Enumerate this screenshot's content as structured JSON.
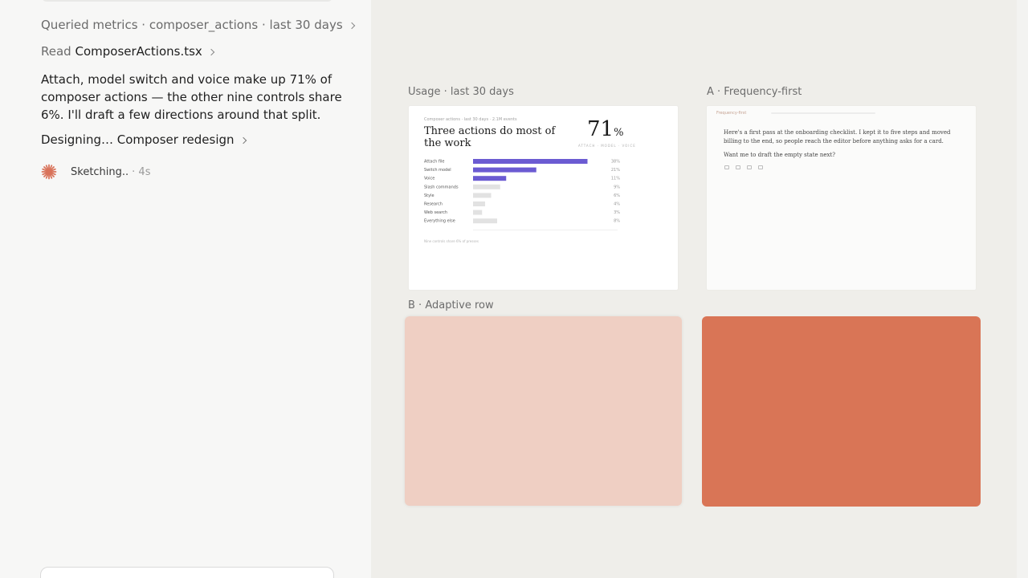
{
  "activity": {
    "queried": {
      "prefix": "Queried metrics · composer_actions · last 30 days"
    },
    "read": {
      "prefix": "Read",
      "file": "ComposerActions.tsx"
    }
  },
  "message": "Attach, model switch and voice make up 71% of composer actions — the other nine controls share 6%. I'll draft a few directions around that split.",
  "designing": "Designing… Composer redesign",
  "sketching": {
    "label": "Sketching..",
    "time": "· 4s"
  },
  "canvas": {
    "usage_label": "Usage · last 30 days",
    "freq_label": "A · Frequency-first",
    "adaptive_label": "B · Adaptive row",
    "colors": {
      "adaptive_light": "#efcfc3",
      "adaptive_dark": "#d97556",
      "bar": "#6b5bd2",
      "bar_muted": "#e2e2e2"
    }
  },
  "usage_card": {
    "kicker": "Composer actions · last 30 days · 2.1M events",
    "title": "Three actions do most of the work",
    "big_number": "71",
    "big_unit": "%",
    "tags": "ATTACH · MODEL · VOICE",
    "footer": "Nine controls share 6% of presses",
    "rows": [
      {
        "label": "Attach file",
        "value": "38%"
      },
      {
        "label": "Switch model",
        "value": "21%"
      },
      {
        "label": "Voice",
        "value": "11%"
      },
      {
        "label": "Slash commands",
        "value": "9%"
      },
      {
        "label": "Style",
        "value": "6%"
      },
      {
        "label": "Research",
        "value": "4%"
      },
      {
        "label": "Web search",
        "value": "3%"
      },
      {
        "label": "Everything else",
        "value": "8%"
      }
    ]
  },
  "chart_data": {
    "type": "bar",
    "categories": [
      "Attach file",
      "Switch model",
      "Voice",
      "Slash commands",
      "Style",
      "Research",
      "Web search",
      "Everything else"
    ],
    "values": [
      38,
      21,
      11,
      9,
      6,
      4,
      3,
      8
    ],
    "title": "Three actions do most of the work",
    "xlabel": "",
    "ylabel": "",
    "xlim": [
      0,
      40
    ]
  },
  "freq_card": {
    "header": "Frequency-first",
    "p1": "Here's a first pass at the onboarding checklist. I kept it to five steps and moved billing to the end, so people reach the editor before anything asks for a card.",
    "p2": "Want me to draft the empty state next?"
  }
}
